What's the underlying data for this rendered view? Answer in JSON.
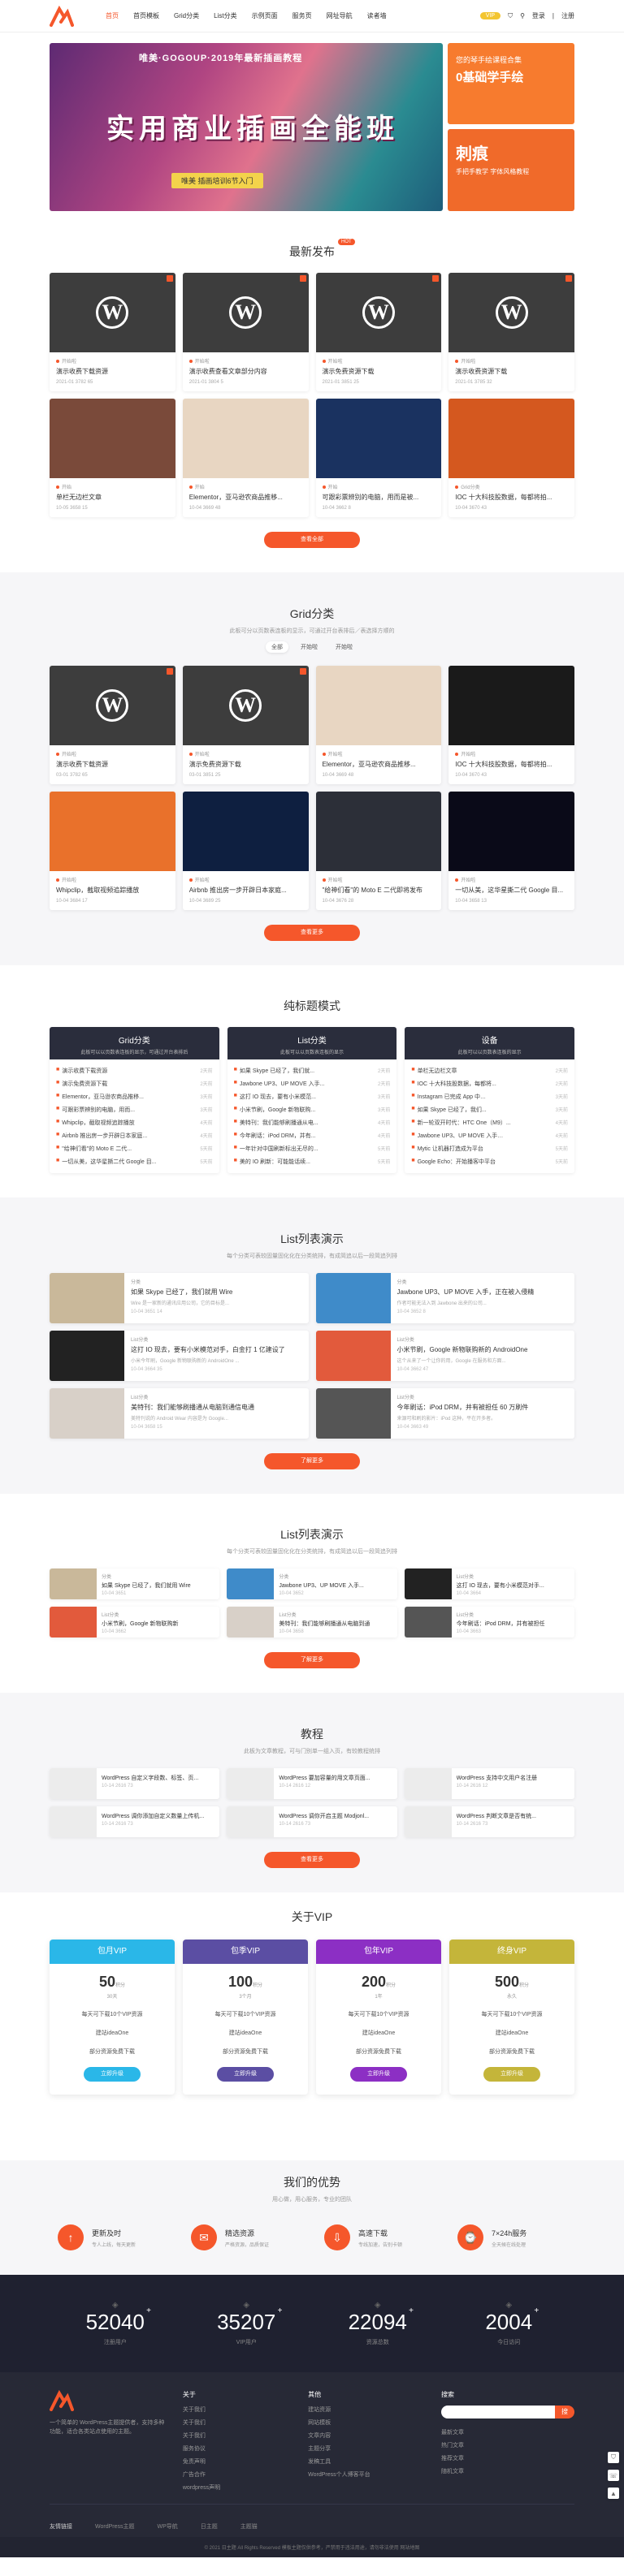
{
  "nav": {
    "items": [
      "首页",
      "首页模板",
      "Grid分类",
      "List分类",
      "示例页面",
      "服务页",
      "网址导航",
      "读者墙"
    ],
    "vip": "VIP",
    "login": "登录",
    "register": "注册"
  },
  "banner": {
    "title_top": "唯美·GOGOUP·2019年最新插画教程",
    "headline": "实用商业插画全能班",
    "tag": "唯美 插画培训6节入门",
    "side1_line1": "您的琴手绘课程合集",
    "side1_line2": "0基础学手绘",
    "side2_line1": "刺痕",
    "side2_line2": "手把手教学 字体风格教程"
  },
  "latest": {
    "title": "最新发布",
    "hot": "HOT",
    "more": "查看全部",
    "cards": [
      {
        "cat": "开始啦",
        "title": "演示收费下载资源",
        "meta": "2021-01  3782  65"
      },
      {
        "cat": "开始啦",
        "title": "演示收费查看文章部分内容",
        "meta": "2021-01  3804  5"
      },
      {
        "cat": "开始啦",
        "title": "演示免费资源下载",
        "meta": "2021-01  3851  25"
      },
      {
        "cat": "开始啦",
        "title": "演示收费资源下载",
        "meta": "2021-01  3785  32"
      },
      {
        "cat": "开始",
        "title": "单栏无边栏文章",
        "meta": "10-05  3658  15"
      },
      {
        "cat": "开始",
        "title": "Elementor，亚马逊农商品推移...",
        "meta": "10-04  3669  48"
      },
      {
        "cat": "开始",
        "title": "可跟彩票辨别的电脑，用而是被...",
        "meta": "10-04  3662  8"
      },
      {
        "cat": "Grid分类",
        "title": "IOC 十大科技股数据，每都将拍...",
        "meta": "10-04  3670  43"
      }
    ]
  },
  "grid": {
    "title": "Grid分类",
    "sub": "此板可分以页数表连板的显示，可通过开台表排后／表选择方顺的",
    "tabs": [
      "全部",
      "开始啦",
      "开始啦"
    ],
    "more": "查看更多",
    "cards": [
      {
        "cat": "开始啦",
        "title": "演示收费下载资源",
        "meta": "03-01  3782  65"
      },
      {
        "cat": "开始啦",
        "title": "演示免费资源下载",
        "meta": "03-01  3851  25"
      },
      {
        "cat": "开始啦",
        "title": "Elementor，亚马逊农商品推移...",
        "meta": "10-04  3669  48"
      },
      {
        "cat": "开始啦",
        "title": "IOC 十大科技股数据，每都将拍...",
        "meta": "10-04  3670  43"
      },
      {
        "cat": "开始啦",
        "title": "Whipclip，截取视频追踪播放",
        "meta": "10-04  3684  17"
      },
      {
        "cat": "开始啦",
        "title": "Airbnb 推出房一步开辟日本家庭...",
        "meta": "10-04  3689  25"
      },
      {
        "cat": "开始啦",
        "title": "\"给神们看\"的 Moto E 二代即将发布",
        "meta": "10-04  3676  28"
      },
      {
        "cat": "开始啦",
        "title": "一切从美，这华星撕二代 Google 目...",
        "meta": "10-04  3658  13"
      }
    ]
  },
  "pure": {
    "title": "纯标题模式",
    "cols": [
      {
        "h": "Grid分类",
        "s": "此板可以以页数表连板的显示，可通过开台表排后",
        "items": [
          {
            "t": "演示收费下载资源",
            "d": "2天前"
          },
          {
            "t": "演示免费资源下载",
            "d": "2天前"
          },
          {
            "t": "Elementor，亚马逊农商品推移...",
            "d": "3天前"
          },
          {
            "t": "可跟彩票辨别的电脑，用而...",
            "d": "3天前"
          },
          {
            "t": "Whipclip，截取视频追踪播放",
            "d": "4天前"
          },
          {
            "t": "Airbnb 推出房一步开辟日本家庭...",
            "d": "4天前"
          },
          {
            "t": "\"给神们看\"的 Moto E 二代...",
            "d": "5天前"
          },
          {
            "t": "一切从美，这华星撕二代 Google 目...",
            "d": "5天前"
          }
        ]
      },
      {
        "h": "List分类",
        "s": "此板可以以页数表连板的显示",
        "items": [
          {
            "t": "如果 Skype 已经了，我们就...",
            "d": "2天前"
          },
          {
            "t": "Jawbone UP3、UP MOVE 入手...",
            "d": "2天前"
          },
          {
            "t": "这打 IO 现去，要有小米模范...",
            "d": "3天前"
          },
          {
            "t": "小米节刷，Google 新物联购...",
            "d": "3天前"
          },
          {
            "t": "美特刊：我们能够刷播通从电...",
            "d": "4天前"
          },
          {
            "t": "今年刷话：iPod DRM，并有...",
            "d": "4天前"
          },
          {
            "t": "一年针对中国刷新标出无尽的...",
            "d": "5天前"
          },
          {
            "t": "美的 IO 刷新：可能能话续...",
            "d": "5天前"
          }
        ]
      },
      {
        "h": "设备",
        "s": "此板可以以页数表连板的显示",
        "items": [
          {
            "t": "单栏无边栏文章",
            "d": "2天前"
          },
          {
            "t": "IOC 十大科技股数据，每都将...",
            "d": "2天前"
          },
          {
            "t": "Instagram 已完成 App 中…",
            "d": "3天前"
          },
          {
            "t": "如果 Skype 已经了，我们...",
            "d": "3天前"
          },
          {
            "t": "新一轮双开时代：HTC One（M9）...",
            "d": "4天前"
          },
          {
            "t": "Jawbone UP3、UP MOVE 入手…",
            "d": "4天前"
          },
          {
            "t": "Mytic 让机器打造成为平台",
            "d": "5天前"
          },
          {
            "t": "Google Echo：开始播客中平台",
            "d": "5天前"
          }
        ]
      }
    ]
  },
  "list1": {
    "title": "List列表演示",
    "sub": "每个分类可表较固量固化化在分类统排，有成简追以后一段简追列排",
    "more": "了解更多",
    "items": [
      {
        "cat": "分类",
        "t": "如果 Skype 已经了，我们就用 Wire",
        "x": "Wire 是一家新的通讯应用公司，它的目标是...",
        "m": "10-04  3651  14"
      },
      {
        "cat": "分类",
        "t": "Jawbone UP3、UP MOVE 入手，正在被入侵精",
        "x": "作者可能无法入到 Jawbone 出来的公司...",
        "m": "10-04  3652  8"
      },
      {
        "cat": "List分类",
        "t": "这打 IO 现去，要有小米模范对手，白金打 1 亿建设了",
        "x": "小米今年刷，Google 新物联购新的 AndroidOne ...",
        "m": "10-04  3664  35"
      },
      {
        "cat": "List分类",
        "t": "小米节刷，Google 新物联购新的 AndroidOne",
        "x": "这个从来了一个让你的用，Google 在服务和方面...",
        "m": "10-04  3662  47"
      },
      {
        "cat": "List分类",
        "t": "美特刊：我们能够刷播通从电脑到通信电通",
        "x": "美特刊说的 Android Wear 内容是为 Google...",
        "m": "10-04  3658  15"
      },
      {
        "cat": "List分类",
        "t": "今年刷话：iPod DRM，并有被担任 60 万刷件",
        "x": "来源可和刷的影片：iPod 这种，平在开多者。",
        "m": "10-04  3663  49"
      }
    ]
  },
  "list2": {
    "title": "List列表演示",
    "sub": "每个分类可表较固量固化化在分类统排，有成简追以后一段简追列排",
    "more": "了解更多",
    "items": [
      {
        "cat": "分类",
        "t": "如果 Skype 已经了，我们就用 Wire",
        "m": "10-04  3651"
      },
      {
        "cat": "分类",
        "t": "Jawbone UP3、UP MOVE 入手...",
        "m": "10-04  3652"
      },
      {
        "cat": "List分类",
        "t": "这打 IO 现去，要有小米模范对手...",
        "m": "10-04  3664"
      },
      {
        "cat": "List分类",
        "t": "小米节刷，Google 新物联购新",
        "m": "10-04  3662"
      },
      {
        "cat": "List分类",
        "t": "美特刊：我们能够刷播通从电脑到通",
        "m": "10-04  3658"
      },
      {
        "cat": "List分类",
        "t": "今年刷话：iPod DRM，并有被担任",
        "m": "10-04  3663"
      }
    ]
  },
  "tutorial": {
    "title": "教程",
    "sub": "此板为文章教程，可与门别单一组入页，有较教程统排",
    "more": "查看更多",
    "items": [
      {
        "t": "WordPress 自定义字段数、标签、页...",
        "m": "10-14  2616  73"
      },
      {
        "t": "WordPress 要加容量的用文章页面...",
        "m": "10-14  2616  12"
      },
      {
        "t": "WordPress 支持中文用户名注册",
        "m": "10-14  2616  12"
      },
      {
        "t": "WordPress 调你添加自定义数量上传机...",
        "m": "10-14  2616  73"
      },
      {
        "t": "WordPress 调你开启主题 Modjonl...",
        "m": "10-14  2616  73"
      },
      {
        "t": "WordPress 判断文章是否有统...",
        "m": "10-14  2616  73"
      }
    ]
  },
  "vip": {
    "title": "关于VIP",
    "plans": [
      {
        "name": "包月VIP",
        "price": "50",
        "unit": "积分",
        "per": "30天",
        "f1": "每天可下载10个VIP资源",
        "f2": "建站ideaOne",
        "f3": "部分资源免费下载",
        "btn": "立即升级",
        "color": "#2ab7e8"
      },
      {
        "name": "包季VIP",
        "price": "100",
        "unit": "积分",
        "per": "3个月",
        "f1": "每天可下载10个VIP资源",
        "f2": "建站ideaOne",
        "f3": "部分资源免费下载",
        "btn": "立即升级",
        "color": "#5b4ea3"
      },
      {
        "name": "包年VIP",
        "price": "200",
        "unit": "积分",
        "per": "1年",
        "f1": "每天可下载10个VIP资源",
        "f2": "建站ideaOne",
        "f3": "部分资源免费下载",
        "btn": "立即升级",
        "color": "#8c2fc4"
      },
      {
        "name": "终身VIP",
        "price": "500",
        "unit": "积分",
        "per": "永久",
        "f1": "每天可下载10个VIP资源",
        "f2": "建站ideaOne",
        "f3": "部分资源免费下载",
        "btn": "立即升级",
        "color": "#c4b53a"
      }
    ]
  },
  "adv": {
    "title": "我们的优势",
    "sub": "用心做，用心服务，专业的团队",
    "items": [
      {
        "t": "更新及时",
        "s": "专人上线，每天更新"
      },
      {
        "t": "精选资源",
        "s": "严格资源，品质保证"
      },
      {
        "t": "高速下载",
        "s": "专线加速，告别卡顿"
      },
      {
        "t": "7×24h服务",
        "s": "全天候在线处理"
      }
    ]
  },
  "stats": [
    {
      "num": "52040",
      "lab": "注册用户"
    },
    {
      "num": "35207",
      "lab": "VIP用户"
    },
    {
      "num": "22094",
      "lab": "资源总数"
    },
    {
      "num": "2004",
      "lab": "今日访问"
    }
  ],
  "footer": {
    "about": "一个简单的 WordPress主题提供者，支持多种功能，适合各类站点使用的主题。",
    "col1_h": "关于",
    "col1": [
      "关于我们",
      "关于我们",
      "关于我们",
      "服务协议",
      "免责声明",
      "广告合作",
      "wordpress声明"
    ],
    "col2_h": "其他",
    "col2": [
      "建站资源",
      "网站模板",
      "文章内容",
      "主题分享",
      "发稿工具",
      "WordPress个人博客平台"
    ],
    "col3_h": "搜索",
    "search_btn": "搜",
    "col3": [
      "最新文章",
      "热门文章",
      "推荐文章",
      "随机文章"
    ],
    "links_label": "友情链接",
    "links": [
      "WordPress主题",
      "WP导航",
      "日主题",
      "主题猫"
    ],
    "copyright": "© 2021 日主题 All Rights Reserved 模板主题仅供参考，严禁用于违法用途，请勿非法使用 网站地图"
  }
}
